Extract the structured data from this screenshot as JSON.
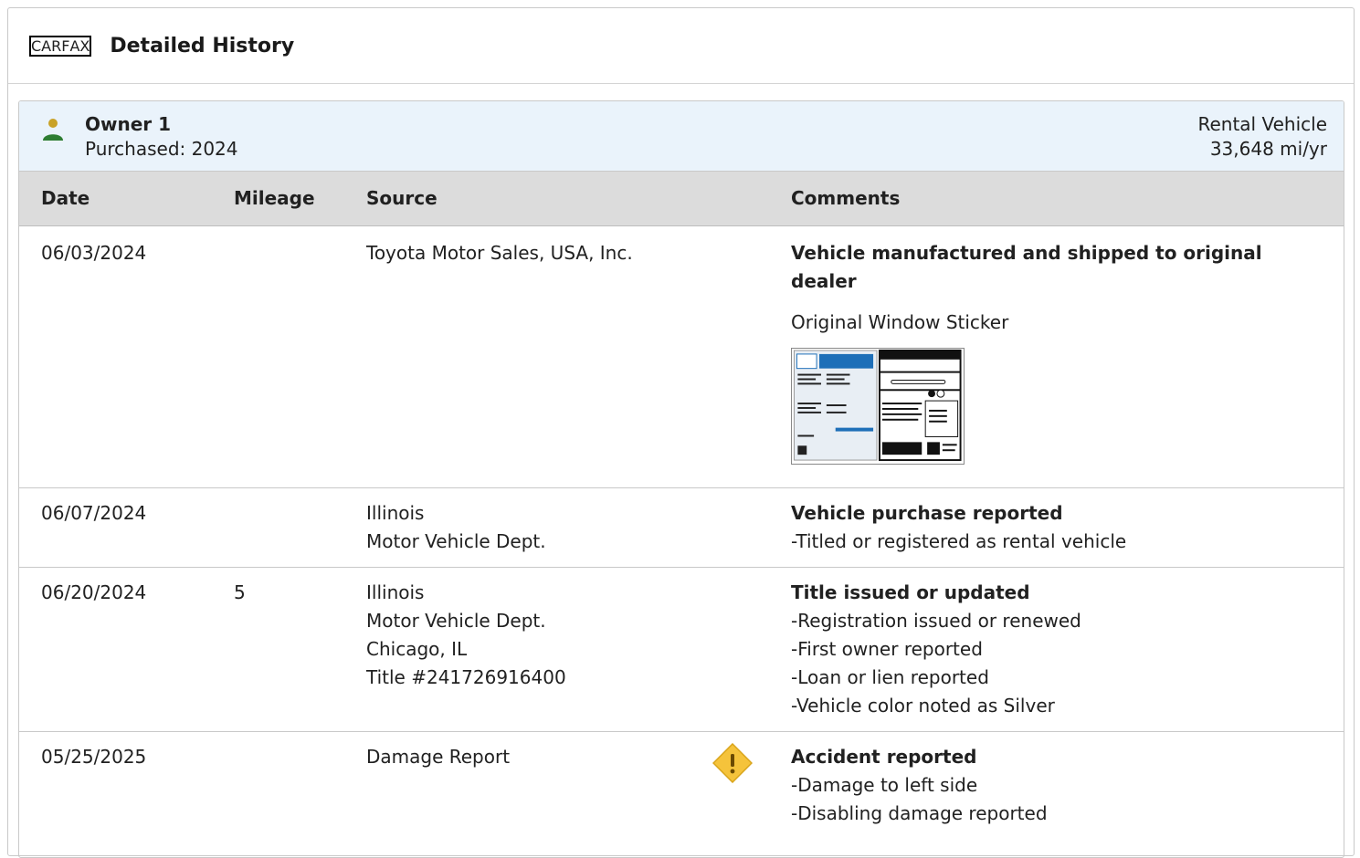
{
  "header": {
    "logo_letters": [
      "C",
      "A",
      "R",
      "F",
      "A",
      "X"
    ],
    "title": "Detailed History"
  },
  "owner": {
    "name": "Owner 1",
    "purchased": "Purchased: 2024",
    "type": "Rental Vehicle",
    "miles_per_year": "33,648 mi/yr",
    "icon": "person-icon",
    "icon_colors": {
      "head": "#c9a227",
      "body": "#2e7d32"
    }
  },
  "table": {
    "columns": [
      "Date",
      "Mileage",
      "Source",
      "Comments"
    ],
    "rows": [
      {
        "date": "06/03/2024",
        "mileage": "",
        "source": [
          "Toyota Motor Sales, USA, Inc."
        ],
        "comment_title": "Vehicle manufactured and shipped to original dealer",
        "comment_lines": [],
        "extra_link": "Original Window Sticker",
        "has_sticker": true
      },
      {
        "date": "06/07/2024",
        "mileage": "",
        "source": [
          "Illinois",
          "Motor Vehicle Dept."
        ],
        "comment_title": "Vehicle purchase reported",
        "comment_lines": [
          "-Titled or registered as rental vehicle"
        ]
      },
      {
        "date": "06/20/2024",
        "mileage": "5",
        "source": [
          "Illinois",
          "Motor Vehicle Dept.",
          "Chicago, IL",
          "Title #241726916400"
        ],
        "comment_title": "Title issued or updated",
        "comment_lines": [
          "-Registration issued or renewed",
          "-First owner reported",
          "-Loan or lien reported",
          "-Vehicle color noted as Silver"
        ]
      },
      {
        "date": "05/25/2025",
        "mileage": "",
        "source": [
          "Damage Report"
        ],
        "comment_title": "Accident reported",
        "comment_lines": [
          "-Damage to left side",
          "-Disabling damage reported"
        ],
        "alert_icon": "warning-diamond-icon",
        "alert_color": "#f5c33b"
      }
    ]
  }
}
